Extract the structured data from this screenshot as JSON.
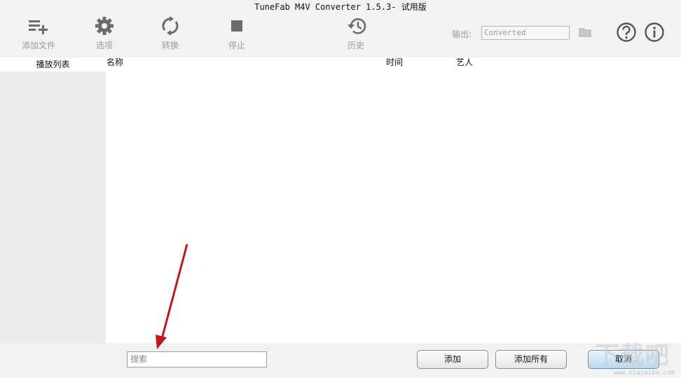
{
  "window": {
    "title": "TuneFab M4V Converter 1.5.3- 试用版"
  },
  "toolbar": {
    "add_files": {
      "label": "添加文件",
      "icon": "playlist-add-icon"
    },
    "options": {
      "label": "选项",
      "icon": "gear-icon"
    },
    "convert": {
      "label": "转换",
      "icon": "sync-icon"
    },
    "stop": {
      "label": "停止",
      "icon": "stop-icon"
    },
    "history": {
      "label": "历史",
      "icon": "history-icon"
    },
    "output_label": "输出:",
    "output_value": "Converted",
    "folder_icon": "folder-icon",
    "help_icon": "help-icon",
    "info_icon": "info-icon"
  },
  "sidebar": {
    "header": "播放列表"
  },
  "table": {
    "columns": [
      "名称",
      "时间",
      "艺人"
    ],
    "rows": []
  },
  "bottom": {
    "search_placeholder": "搜索",
    "add_label": "添加",
    "add_all_label": "添加所有",
    "cancel_label": "取消"
  },
  "watermark": {
    "text": "下载吧",
    "sub": "www.xiazaiba.com"
  },
  "colors": {
    "toolbar_bg": "#f2f2f2",
    "icon_gray": "#6b6b6b",
    "label_gray": "#9a9a9a",
    "annotation_arrow": "#c0181b",
    "cancel_button": "#b8d8ef"
  }
}
